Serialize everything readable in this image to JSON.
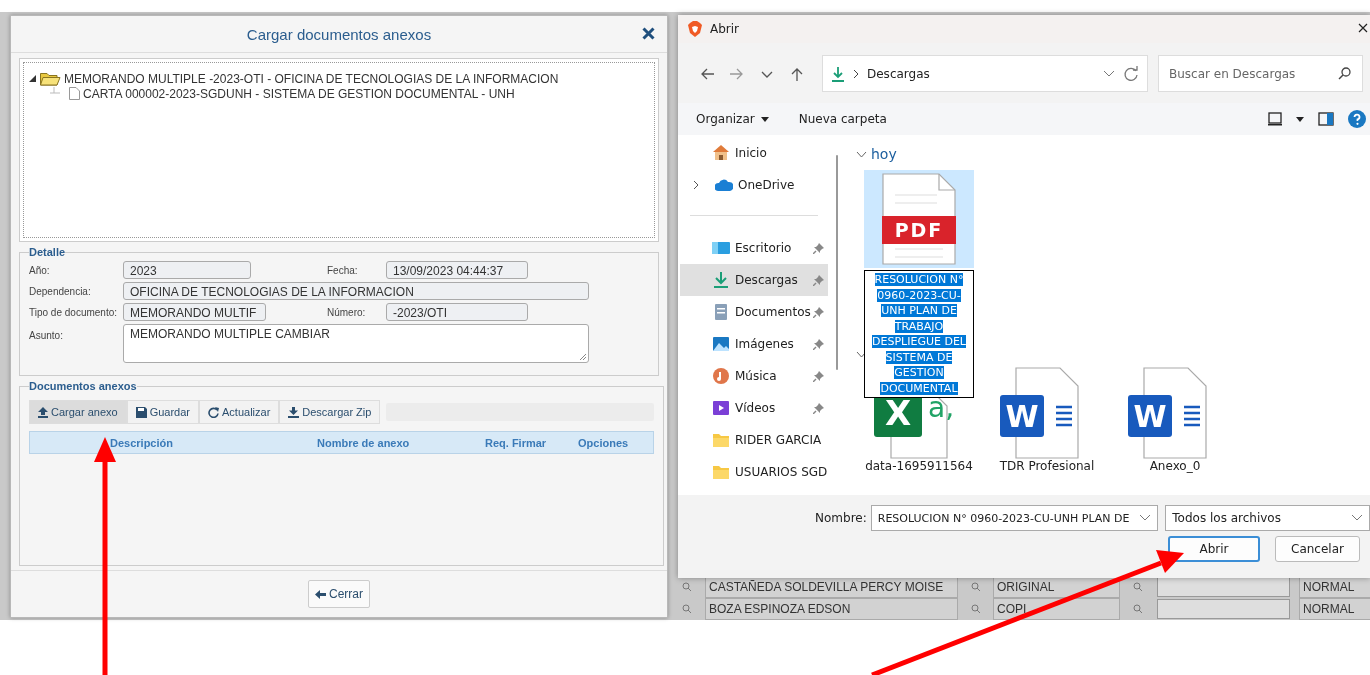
{
  "background_page": {
    "rows": [
      {
        "name": "CASTAÑEDA SOLDEVILLA PERCY MOISE",
        "copy_type": "ORIGINAL",
        "priority": "NORMAL"
      },
      {
        "name": "BOZA ESPINOZA EDSON",
        "copy_type": "COPI",
        "priority": "NORMAL"
      }
    ]
  },
  "attachments_dialog": {
    "title": "Cargar documentos anexos",
    "tree": [
      {
        "label": "MEMORANDO MULTIPLE -2023-OTI - OFICINA DE TECNOLOGIAS DE LA INFORMACION",
        "expanded": true,
        "children": [
          {
            "label": "CARTA 000002-2023-SGDUNH - SISTEMA DE GESTION DOCUMENTAL - UNH"
          }
        ]
      }
    ],
    "detail": {
      "legend": "Detalle",
      "fields": [
        {
          "label": "Año:",
          "value": "2023",
          "kind": "input"
        },
        {
          "label": "Fecha:",
          "value": "13/09/2023 04:44:37",
          "kind": "input"
        },
        {
          "label": "Dependencia:",
          "value": "OFICINA DE TECNOLOGIAS DE LA INFORMACION",
          "kind": "input"
        },
        {
          "label": "Tipo de documento:",
          "value": "MEMORANDO MULTIF",
          "kind": "input"
        },
        {
          "label": "Número:",
          "value": "-2023/OTI",
          "kind": "input"
        },
        {
          "label": "Asunto:",
          "value": "MEMORANDO MULTIPLE CAMBIAR",
          "kind": "textarea"
        }
      ]
    },
    "attachments": {
      "legend": "Documentos anexos",
      "toolbar": [
        {
          "label": "Cargar anexo",
          "kind": "upload",
          "selected": true
        },
        {
          "label": "Guardar",
          "kind": "save",
          "selected": false
        },
        {
          "label": "Actualizar",
          "kind": "refresh",
          "selected": false
        },
        {
          "label": "Descargar Zip",
          "kind": "download",
          "selected": false
        }
      ],
      "columns": [
        "Descripción",
        "Nombre de anexo",
        "Req. Firmar",
        "Opciones"
      ]
    },
    "close_button": "Cerrar"
  },
  "open_dialog": {
    "title": "Abrir",
    "address": "Descargas",
    "search": {
      "placeholder": "Buscar en Descargas"
    },
    "commands": [
      {
        "label": "Organizar",
        "menu": true
      },
      {
        "label": "Nueva carpeta",
        "menu": false
      }
    ],
    "nav_items": [
      {
        "label": "Inicio",
        "kind": "home",
        "pinned": false,
        "expandable": false,
        "selected": false
      },
      {
        "label": "OneDrive",
        "kind": "cloud",
        "pinned": false,
        "expandable": true,
        "selected": false
      },
      {
        "label": "Escritorio",
        "kind": "desktop",
        "pinned": true,
        "expandable": false,
        "selected": false
      },
      {
        "label": "Descargas",
        "kind": "download",
        "pinned": true,
        "expandable": false,
        "selected": true
      },
      {
        "label": "Documentos",
        "kind": "document",
        "pinned": true,
        "expandable": false,
        "selected": false
      },
      {
        "label": "Imágenes",
        "kind": "image",
        "pinned": true,
        "expandable": false,
        "selected": false
      },
      {
        "label": "Música",
        "kind": "music",
        "pinned": true,
        "expandable": false,
        "selected": false
      },
      {
        "label": "Vídeos",
        "kind": "video",
        "pinned": true,
        "expandable": false,
        "selected": false
      },
      {
        "label": "RIDER GARCIA",
        "kind": "folder",
        "pinned": false,
        "expandable": false,
        "selected": false
      },
      {
        "label": "USUARIOS SGD",
        "kind": "folder",
        "pinned": false,
        "expandable": false,
        "selected": false
      }
    ],
    "groups": [
      {
        "label": "hoy",
        "files": [
          {
            "kind": "pdf",
            "icon_label": "PDF",
            "rename_value": "RESOLUCION N° 0960-2023-CU-UNH PLAN DE TRABAJO DESPLIEGUE DEL SISTEMA DE GESTION DOCUMENTAL",
            "selected": true
          }
        ]
      },
      {
        "files": [
          {
            "kind": "excel",
            "icon_label": "X",
            "icon_sublabel": "a,",
            "name": "data-1695911564",
            "selected": false
          },
          {
            "kind": "word",
            "icon_label": "W",
            "name": "TDR Profesional",
            "selected": false
          },
          {
            "kind": "word",
            "icon_label": "W",
            "name": "Anexo_0",
            "selected": false
          }
        ]
      }
    ],
    "filename_label": "Nombre:",
    "filename_value": "RESOLUCION N° 0960-2023-CU-UNH PLAN DE",
    "filter": "Todos los archivos",
    "buttons": [
      {
        "label": "Abrir",
        "default": true
      },
      {
        "label": "Cancelar",
        "default": false
      }
    ]
  },
  "annotations": [
    {
      "kind": "arrow"
    },
    {
      "kind": "arrow"
    }
  ]
}
